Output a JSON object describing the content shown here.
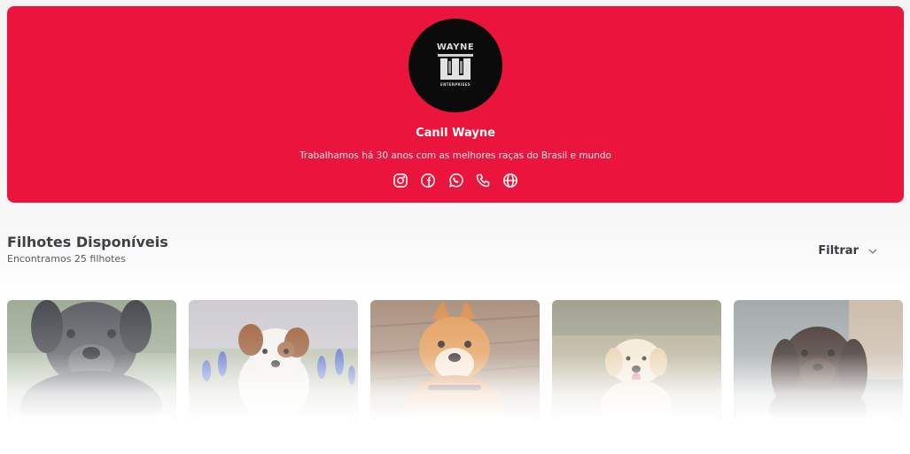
{
  "hero": {
    "background_color": "#ea143c",
    "logo": {
      "top_text": "WAYNE",
      "bottom_text": "ENTERPRISES"
    },
    "title": "Canil Wayne",
    "subtitle": "Trabalhamos há 30 anos com as melhores raças do Brasil e mundo",
    "social_icons": [
      "instagram-icon",
      "facebook-icon",
      "whatsapp-icon",
      "phone-icon",
      "globe-icon"
    ]
  },
  "section": {
    "title": "Filhotes Disponíveis",
    "subtitle": "Encontramos 25 filhotes"
  },
  "filter": {
    "label": "Filtrar"
  },
  "cards": [
    {
      "name": "puppy-card-1",
      "description": "grey puppy on grass"
    },
    {
      "name": "puppy-card-2",
      "description": "white and brown puppy among blue flowers"
    },
    {
      "name": "puppy-card-3",
      "description": "shiba inu puppy on wooden deck"
    },
    {
      "name": "puppy-card-4",
      "description": "cream puppy on field"
    },
    {
      "name": "puppy-card-5",
      "description": "dark brown spaniel puppy"
    }
  ]
}
